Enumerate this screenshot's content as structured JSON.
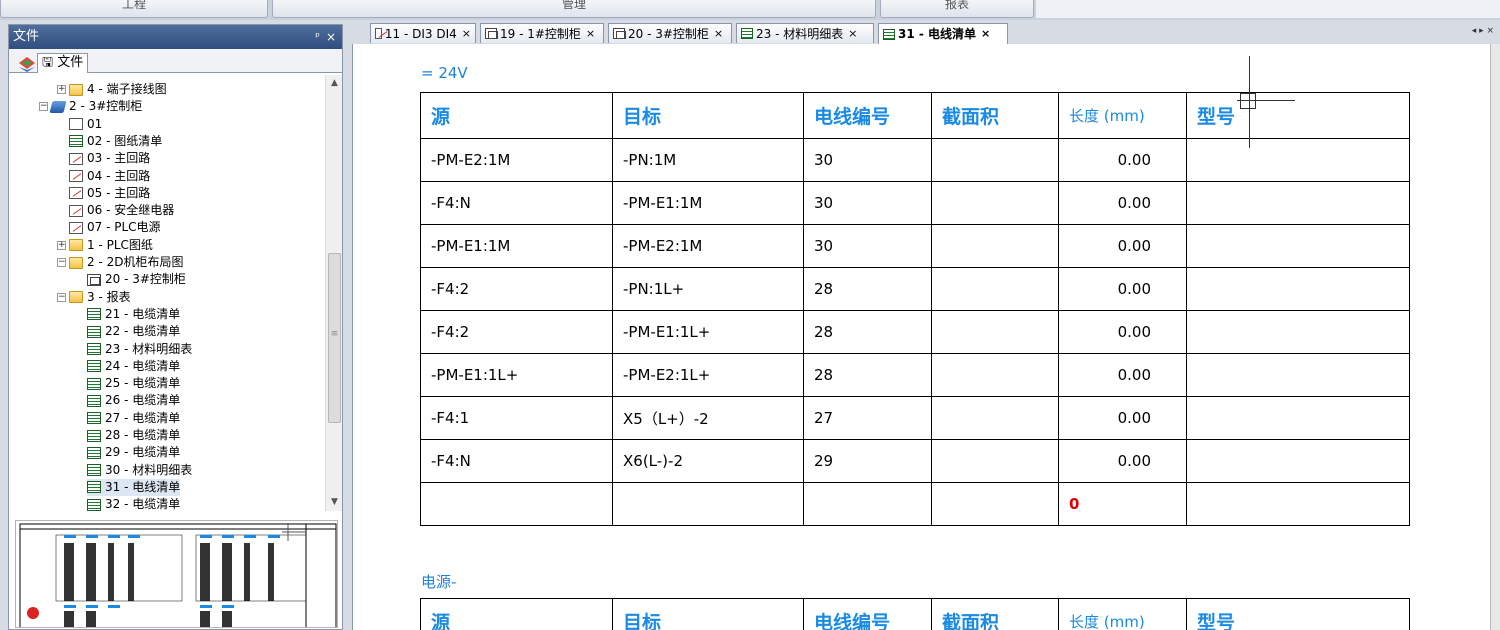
{
  "ribbon": {
    "btn1": "工程",
    "btn2": "管理",
    "btn3": "报表"
  },
  "left_panel": {
    "title": "文件",
    "pin": "ᵖ",
    "close": "×",
    "tab_label": "文件",
    "tree": [
      {
        "label": "4 - 端子接线图",
        "indent": 0,
        "exp": "+",
        "icon": "folder"
      },
      {
        "label": "2 - 3#控制柜",
        "indent": -1,
        "exp": "−",
        "icon": "proj"
      },
      {
        "label": "01",
        "indent": 1,
        "exp": "",
        "icon": "sheet"
      },
      {
        "label": "02 - 图纸清单",
        "indent": 1,
        "exp": "",
        "icon": "grid"
      },
      {
        "label": "03 - 主回路",
        "indent": 1,
        "exp": "",
        "icon": "draw"
      },
      {
        "label": "04 - 主回路",
        "indent": 1,
        "exp": "",
        "icon": "draw"
      },
      {
        "label": "05 - 主回路",
        "indent": 1,
        "exp": "",
        "icon": "draw"
      },
      {
        "label": "06 - 安全继电器",
        "indent": 1,
        "exp": "",
        "icon": "draw"
      },
      {
        "label": "07 - PLC电源",
        "indent": 1,
        "exp": "",
        "icon": "draw"
      },
      {
        "label": "1 - PLC图纸",
        "indent": 0,
        "exp": "+",
        "icon": "folder"
      },
      {
        "label": "2 - 2D机柜布局图",
        "indent": 0,
        "exp": "−",
        "icon": "folder"
      },
      {
        "label": "20 - 3#控制柜",
        "indent": 2,
        "exp": "",
        "icon": "cab"
      },
      {
        "label": "3 - 报表",
        "indent": 0,
        "exp": "−",
        "icon": "folder"
      },
      {
        "label": "21 - 电缆清单",
        "indent": 2,
        "exp": "",
        "icon": "grid"
      },
      {
        "label": "22 - 电缆清单",
        "indent": 2,
        "exp": "",
        "icon": "grid"
      },
      {
        "label": "23 - 材料明细表",
        "indent": 2,
        "exp": "",
        "icon": "grid"
      },
      {
        "label": "24 - 电缆清单",
        "indent": 2,
        "exp": "",
        "icon": "grid"
      },
      {
        "label": "25 - 电缆清单",
        "indent": 2,
        "exp": "",
        "icon": "grid"
      },
      {
        "label": "26 - 电缆清单",
        "indent": 2,
        "exp": "",
        "icon": "grid"
      },
      {
        "label": "27 - 电缆清单",
        "indent": 2,
        "exp": "",
        "icon": "grid"
      },
      {
        "label": "28 - 电缆清单",
        "indent": 2,
        "exp": "",
        "icon": "grid"
      },
      {
        "label": "29 - 电缆清单",
        "indent": 2,
        "exp": "",
        "icon": "grid"
      },
      {
        "label": "30 - 材料明细表",
        "indent": 2,
        "exp": "",
        "icon": "grid"
      },
      {
        "label": "31 - 电线清单",
        "indent": 2,
        "exp": "",
        "icon": "grid",
        "selected": true
      },
      {
        "label": "32 - 电缆清单",
        "indent": 2,
        "exp": "",
        "icon": "grid"
      }
    ]
  },
  "tabs": [
    {
      "label": "11 - DI3 DI4",
      "icon": "draw"
    },
    {
      "label": "19 - 1#控制柜",
      "icon": "cab"
    },
    {
      "label": "20 - 3#控制柜",
      "icon": "cab"
    },
    {
      "label": "23 - 材料明细表",
      "icon": "grid"
    },
    {
      "label": "31 - 电线清单",
      "icon": "grid",
      "active": true
    }
  ],
  "tab_close": "×",
  "tab_nav": "◂ ▸ ×",
  "document": {
    "section1_label": "=  24V",
    "section2_label": "电源-",
    "headers": [
      "源",
      "目标",
      "电线编号",
      "截面积",
      "长度 (mm)",
      "型号"
    ],
    "rows": [
      [
        "-PM-E2:1M",
        "-PN:1M",
        "30",
        "",
        "0.00",
        ""
      ],
      [
        "-F4:N",
        "-PM-E1:1M",
        "30",
        "",
        "0.00",
        ""
      ],
      [
        "-PM-E1:1M",
        "-PM-E2:1M",
        "30",
        "",
        "0.00",
        ""
      ],
      [
        "-F4:2",
        "-PN:1L+",
        "28",
        "",
        "0.00",
        ""
      ],
      [
        "-F4:2",
        "-PM-E1:1L+",
        "28",
        "",
        "0.00",
        ""
      ],
      [
        "-PM-E1:1L+",
        "-PM-E2:1L+",
        "28",
        "",
        "0.00",
        ""
      ],
      [
        "-F4:1",
        "X5（L+）-2",
        "27",
        "",
        "0.00",
        ""
      ],
      [
        "-F4:N",
        "X6(L-)-2",
        "29",
        "",
        "0.00",
        ""
      ]
    ],
    "total_length": "0"
  },
  "colors": {
    "header_text": "#1a8ae3",
    "section_label": "#1f82d8",
    "total": "#e00000",
    "panel_title": "#2f4f80"
  }
}
